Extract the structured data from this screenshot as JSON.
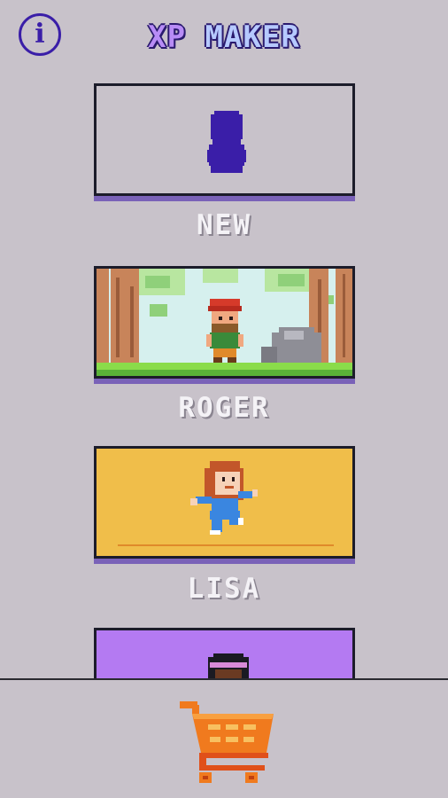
{
  "header": {
    "info_icon": "i",
    "title_part1": "XP",
    "title_part2": "MAKER"
  },
  "cards": [
    {
      "label": "NEW",
      "icon": "character-silhouette-icon"
    },
    {
      "label": "ROGER",
      "icon": "roger-forest-scene"
    },
    {
      "label": "LISA",
      "icon": "lisa-character"
    },
    {
      "label": "",
      "icon": "fourth-character-partial"
    }
  ],
  "footer": {
    "cart_icon": "shopping-cart-icon"
  },
  "colors": {
    "background": "#c8c2ca",
    "accent_purple": "#3a1ea8",
    "card_shadow": "#7a62b8",
    "lisa_bg": "#f0be4a",
    "fourth_bg": "#b47af2",
    "cart_orange": "#f07a1e"
  }
}
